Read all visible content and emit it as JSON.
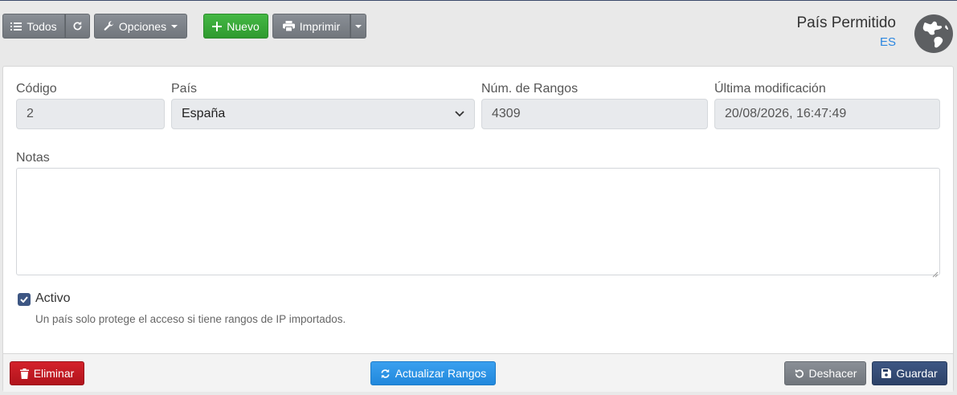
{
  "toolbar": {
    "all_label": "Todos",
    "options_label": "Opciones",
    "new_label": "Nuevo",
    "print_label": "Imprimir"
  },
  "header": {
    "title": "País Permitido",
    "subtitle": "ES"
  },
  "form": {
    "code": {
      "label": "Código",
      "value": "2"
    },
    "country": {
      "label": "País",
      "value": "España"
    },
    "ranges": {
      "label": "Núm. de Rangos",
      "value": "4309"
    },
    "modified": {
      "label": "Última modificación",
      "value": "20/08/2026, 16:47:49"
    },
    "notes": {
      "label": "Notas",
      "value": ""
    },
    "active": {
      "label": "Activo",
      "checked": true
    },
    "help_text": "Un país solo protege el acceso si tiene rangos de IP importados."
  },
  "footer": {
    "delete_label": "Eliminar",
    "update_ranges_label": "Actualizar Rangos",
    "undo_label": "Deshacer",
    "save_label": "Guardar"
  },
  "colors": {
    "primary": "#3d5683",
    "success": "#2f9a2f",
    "danger": "#b1141c",
    "info": "#2188dc",
    "link": "#2b86e0"
  },
  "icons": [
    "list-icon",
    "refresh-icon",
    "wrench-icon",
    "caret-down-icon",
    "plus-icon",
    "print-icon",
    "globe-icon",
    "chevron-down-icon",
    "check-icon",
    "trash-icon",
    "sync-icon",
    "undo-icon",
    "save-icon"
  ]
}
